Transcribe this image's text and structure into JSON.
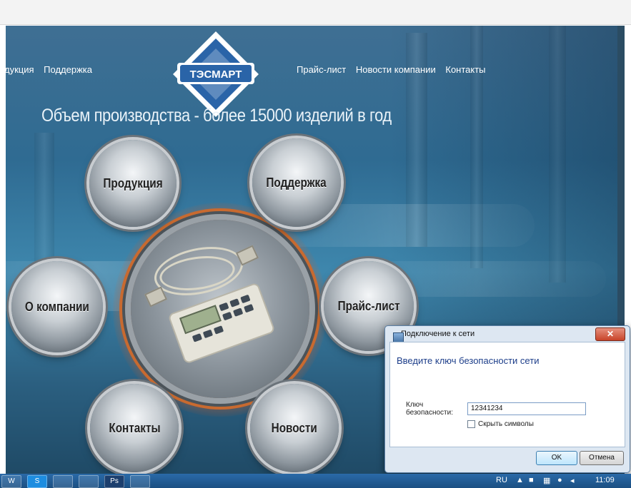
{
  "site": {
    "nav_left": [
      "дукция",
      "Поддержка"
    ],
    "nav_right": [
      "Прайс-лист",
      "Новости компании",
      "Контакты"
    ],
    "logo_text": "ТЭСМАРТ",
    "tagline": "Объем производства - более 15000 изделий в год",
    "buttons": {
      "products": "Продукция",
      "support": "Поддержка",
      "about": "О компании",
      "pricelist": "Прайс-лист",
      "contacts": "Контакты",
      "news": "Новости"
    }
  },
  "dialog": {
    "title": "Подключение к сети",
    "close_label": "✕",
    "heading": "Введите ключ безопасности сети",
    "key_label": "Ключ безопасности:",
    "key_value": "12341234",
    "hide_chars_label": "Скрыть символы",
    "hide_chars_checked": false,
    "ok_label": "OK",
    "cancel_label": "Отмена"
  },
  "taskbar": {
    "apps": [
      "W",
      "S",
      "",
      "",
      "Ps",
      ""
    ],
    "lang": "RU",
    "clock": "11:09"
  },
  "colors": {
    "taskbar": "#1b4f82",
    "dialog_heading": "#1d3e8a",
    "glow": "#ff8c3c"
  }
}
